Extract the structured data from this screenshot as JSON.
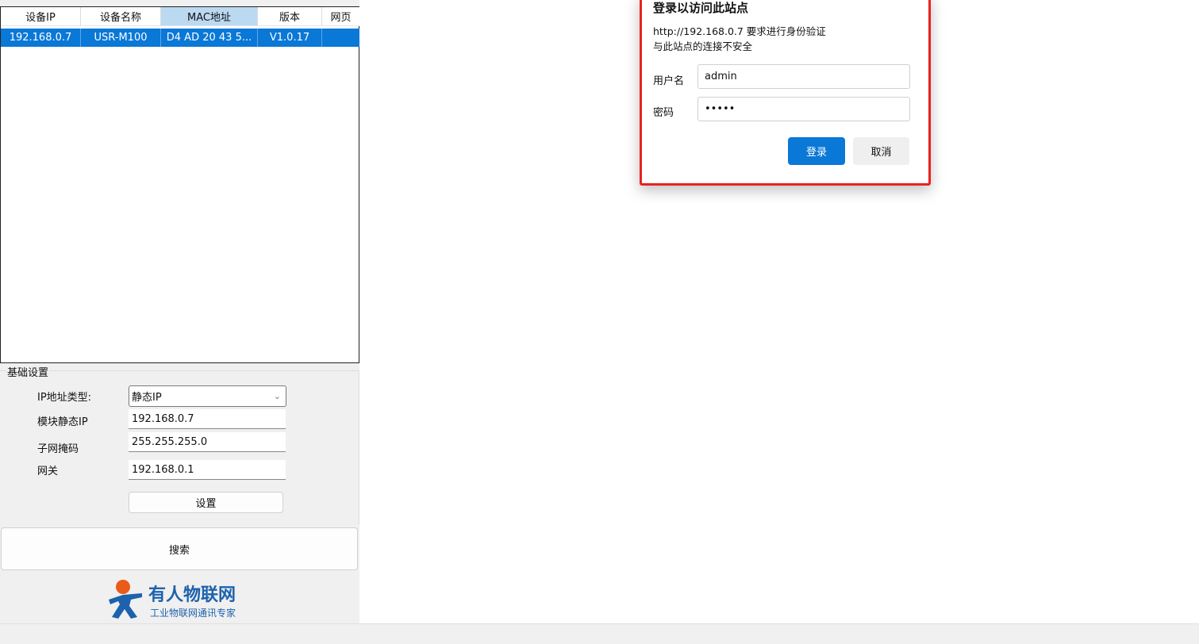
{
  "table": {
    "headers": [
      "设备IP",
      "设备名称",
      "MAC地址",
      "版本",
      "网页"
    ],
    "rows": [
      [
        "192.168.0.7",
        "USR-M100",
        "D4 AD 20 43 5...",
        "V1.0.17",
        ""
      ]
    ]
  },
  "basic": {
    "title": "基础设置",
    "ip_type_label": "IP地址类型:",
    "ip_type_value": "静态IP",
    "static_ip_label": "模块静态IP",
    "static_ip": "192.168.0.7",
    "mask_label": "子网掩码",
    "mask": "255.255.255.0",
    "gateway_label": "网关",
    "gateway": "192.168.0.1",
    "set_label": "设置"
  },
  "search_label": "搜索",
  "logo": {
    "name": "有人物联网",
    "slogan": "工业物联网通讯专家"
  },
  "dialog": {
    "title": "登录以访问此站点",
    "line1": "http://192.168.0.7 要求进行身份验证",
    "line2": "与此站点的连接不安全",
    "user_label": "用户名",
    "user_value": "admin",
    "pass_label": "密码",
    "pass_value": "•••••",
    "login": "登录",
    "cancel": "取消"
  },
  "colors": {
    "accent": "#0a78d7",
    "highlight": "#e8231e"
  }
}
